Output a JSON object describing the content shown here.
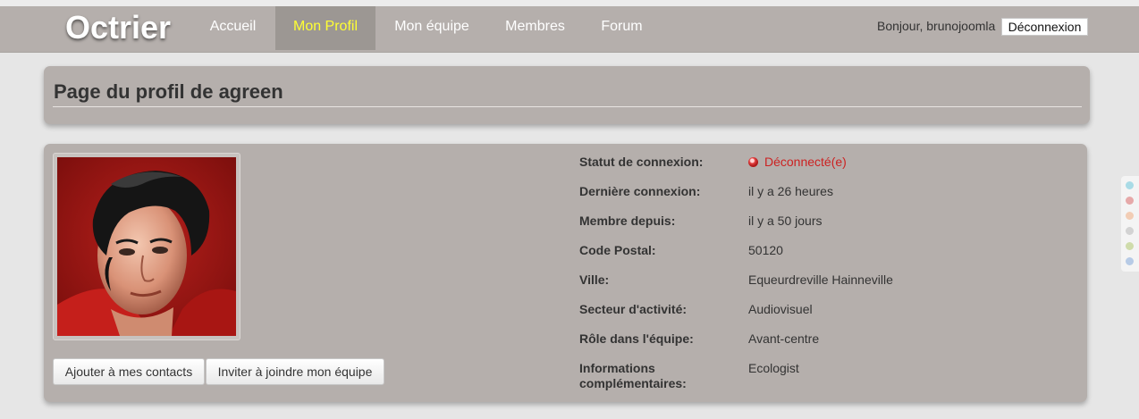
{
  "header": {
    "brand": "Octrier",
    "nav": [
      {
        "label": "Accueil",
        "active": false
      },
      {
        "label": "Mon Profil",
        "active": true
      },
      {
        "label": "Mon équipe",
        "active": false
      },
      {
        "label": "Membres",
        "active": false
      },
      {
        "label": "Forum",
        "active": false
      }
    ],
    "greeting": "Bonjour, brunojoomla",
    "logout_label": "Déconnexion"
  },
  "page": {
    "title": "Page du profil de agreen"
  },
  "profile": {
    "photo": "profile-photo",
    "actions": {
      "add_contact": "Ajouter à mes contacts",
      "invite_team": "Inviter à joindre mon équipe"
    },
    "fields": [
      {
        "label": "Statut de connexion:",
        "value": "Déconnecté(e)"
      },
      {
        "label": "Dernière connexion:",
        "value": "il y a 26 heures"
      },
      {
        "label": "Membre depuis:",
        "value": "il y a 50 jours"
      },
      {
        "label": "Code Postal:",
        "value": "50120"
      },
      {
        "label": "Ville:",
        "value": "Equeurdreville Hainneville"
      },
      {
        "label": "Secteur d'activité:",
        "value": "Audiovisuel"
      },
      {
        "label": "Rôle dans l'équipe:",
        "value": "Avant-centre"
      },
      {
        "label": "Informations complémentaires:",
        "value": "Ecologist"
      }
    ]
  },
  "colors": {
    "navbar": "#b5afac",
    "active_nav_text": "#ffff33",
    "status_offline": "#cc2222",
    "side_dots": [
      "#a9dbe6",
      "#e6a9a9",
      "#f2cdb5",
      "#d3d3d3",
      "#cfdcab",
      "#b7cbe6"
    ]
  }
}
